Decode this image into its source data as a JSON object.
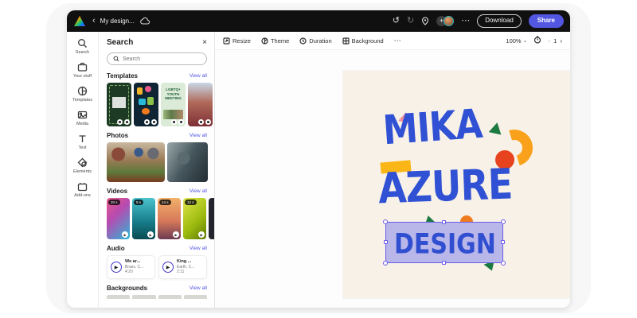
{
  "colors": {
    "topbar_bg": "#101010",
    "accent_indigo": "#5256e0",
    "artboard_cream": "#f8f1e8",
    "lettering_blue": "#3051d3",
    "selection_lavender": "#b9b6ea",
    "selection_border": "#6a5ce8",
    "shape_orange": "#f9a11b",
    "shape_red": "#e8431f",
    "shape_green": "#1d7a40",
    "shape_pink": "#ef8fa0",
    "shape_yellow": "#f9b616"
  },
  "icons": {
    "back": "‹",
    "undo": "↺",
    "redo": "↻",
    "more": "⋯",
    "close": "×",
    "caret": "⌄",
    "chev_left": "‹",
    "chev_right": "›",
    "plus": "+",
    "play": "▶"
  },
  "topbar": {
    "title": "My design...",
    "download": "Download",
    "share": "Share"
  },
  "rail": {
    "items": [
      {
        "label": "Search",
        "icon": "search-icon"
      },
      {
        "label": "Your stuff",
        "icon": "your-stuff-icon"
      },
      {
        "label": "Templates",
        "icon": "templates-icon"
      },
      {
        "label": "Media",
        "icon": "media-icon"
      },
      {
        "label": "Text",
        "icon": "text-icon"
      },
      {
        "label": "Elements",
        "icon": "elements-icon"
      },
      {
        "label": "Add-ons",
        "icon": "add-ons-icon"
      }
    ]
  },
  "panel": {
    "title": "Search",
    "input_placeholder": "Search",
    "sections": {
      "templates": {
        "title": "Templates",
        "view_all": "View all"
      },
      "photos": {
        "title": "Photos",
        "view_all": "View all"
      },
      "videos": {
        "title": "Videos",
        "view_all": "View all",
        "durations": [
          "20 s",
          "9 s",
          "14 s",
          "12 s"
        ]
      },
      "audio": {
        "title": "Audio",
        "view_all": "View all",
        "tracks": [
          {
            "title": "We ar...",
            "subtitle": "Brass, C...",
            "duration": "4:20"
          },
          {
            "title": "King ...",
            "subtitle": "Earth, C...",
            "duration": "2:11"
          }
        ]
      },
      "backgrounds": {
        "title": "Backgrounds",
        "view_all": "View all"
      }
    },
    "template_captions": {
      "lgbtq": "LGBTQ+ YOUTH MEETING"
    }
  },
  "canvas_toolbar": {
    "resize": "Resize",
    "theme": "Theme",
    "duration": "Duration",
    "background": "Background",
    "zoom": "100%",
    "page": "1"
  },
  "artboard": {
    "line1": "MIKA",
    "line2": "AZURE",
    "line3": "DESIGN"
  }
}
